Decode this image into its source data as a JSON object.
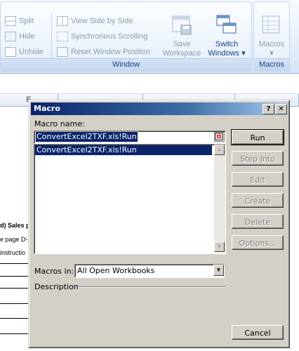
{
  "ribbon": {
    "window_group": {
      "label": "Window",
      "split": "Split",
      "hide": "Hide",
      "unhide": "Unhide",
      "view_side_by_side": "View Side by Side",
      "synchronous_scrolling": "Synchronous Scrolling",
      "reset_window_position": "Reset Window Position",
      "save_workspace_line1": "Save",
      "save_workspace_line2": "Workspace",
      "switch_windows_line1": "Switch",
      "switch_windows_line2": "Windows ▾"
    },
    "macros_group": {
      "label": "Macros",
      "macros_line1": "Macros",
      "macros_line2": "▾"
    }
  },
  "sheet": {
    "columns": [
      "E",
      "",
      "",
      ""
    ],
    "cell_texts": [
      "d) Sales p",
      "e page D-",
      "instructio"
    ]
  },
  "dialog": {
    "title": "Macro",
    "help_button": "?",
    "close_button": "✕",
    "macro_name_label": "Macro name:",
    "macro_name_value": "ConvertExcel2TXF.xls!Run",
    "macro_list": [
      "ConvertExcel2TXF.xls!Run"
    ],
    "macros_in_label": "Macros in:",
    "macros_in_value": "All Open Workbooks",
    "description_label": "Description",
    "buttons": {
      "run": "Run",
      "step_into": "Step Into",
      "edit": "Edit",
      "create": "Create",
      "delete": "Delete",
      "options": "Options...",
      "cancel": "Cancel"
    }
  }
}
